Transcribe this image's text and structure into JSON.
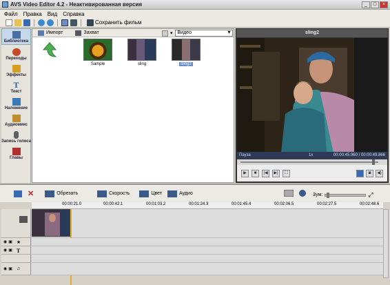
{
  "window": {
    "title": "AVS Video Editor 4.2 - Неактивированная версия"
  },
  "menu": [
    "Файл",
    "Правка",
    "Вид",
    "Справка"
  ],
  "toolbar": {
    "save_label": "Сохранить фильм"
  },
  "sidebar": {
    "items": [
      {
        "label": "Библиотека",
        "icon": "library-icon",
        "color": "#4a6fa5"
      },
      {
        "label": "Переходы",
        "icon": "transitions-icon",
        "color": "#c04a2a"
      },
      {
        "label": "Эффекты",
        "icon": "effects-icon",
        "color": "#d8a020"
      },
      {
        "label": "Текст",
        "icon": "text-icon",
        "color": "#2a5fa8"
      },
      {
        "label": "Наложение",
        "icon": "overlay-icon",
        "color": "#3a7ab8"
      },
      {
        "label": "Аудиомикс",
        "icon": "audiomix-icon",
        "color": "#c09030"
      },
      {
        "label": "Запись голоса",
        "icon": "voice-record-icon",
        "color": "#606060"
      },
      {
        "label": "Главы",
        "icon": "chapters-icon",
        "color": "#b03030"
      }
    ]
  },
  "library": {
    "import_label": "Импорт",
    "capture_label": "Захват",
    "filter_value": "Видео",
    "items": [
      {
        "label": "Sample"
      },
      {
        "label": "sling"
      },
      {
        "label": "sling2"
      }
    ]
  },
  "preview": {
    "title": "sling2",
    "status": "Пауза",
    "speed": "1x",
    "time": "00:00:45.960 / 00:00:49.866"
  },
  "timeline": {
    "tools": {
      "trim_label": "Обрезать",
      "speed_label": "Скорость",
      "color_label": "Цвет",
      "audio_label": "Аудио",
      "zoom_label": "Зум:"
    },
    "ruler": [
      "00:00:21.0",
      "00:00:42.1",
      "00:01:03.2",
      "00:01:24.3",
      "00:01:45.4",
      "00:02:06.5",
      "00:02:27.5",
      "00:02:48.6"
    ]
  }
}
